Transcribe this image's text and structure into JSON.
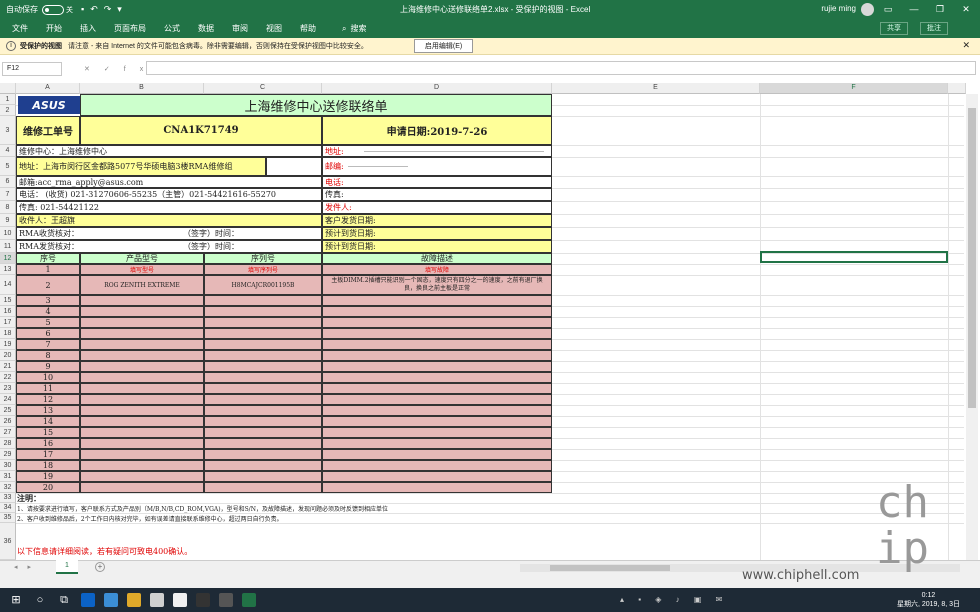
{
  "titlebar": {
    "autosave": "自动保存",
    "autosave_state": "关",
    "title": "上海维修中心送修联络单2.xlsx  -  受保护的视图  -  Excel",
    "user": "rujie ming"
  },
  "menu": {
    "items": [
      "文件",
      "开始",
      "插入",
      "页面布局",
      "公式",
      "数据",
      "审阅",
      "视图",
      "帮助"
    ],
    "search": "搜索",
    "share": "共享",
    "comment": "批注"
  },
  "protected_bar": {
    "label": "受保护的视图",
    "message": "请注意 - 来自 Internet 的文件可能包含病毒。除非需要编辑，否则保持在受保护视图中比较安全。",
    "button": "启用编辑(E)"
  },
  "formula_bar": {
    "name_box": "F12",
    "cancel": "✕",
    "confirm": "✓",
    "fx": "fx"
  },
  "columns": [
    "A",
    "B",
    "C",
    "D",
    "E",
    "F"
  ],
  "rows": [
    "1",
    "2",
    "3",
    "4",
    "5",
    "6",
    "7",
    "8",
    "9",
    "10",
    "11",
    "12",
    "13",
    "14",
    "15",
    "16",
    "17",
    "18",
    "19",
    "20",
    "21",
    "22",
    "23",
    "24",
    "25",
    "26",
    "27",
    "28",
    "29",
    "30",
    "31",
    "32",
    "33",
    "34",
    "35",
    "36"
  ],
  "sheet": {
    "logo": "ASUS",
    "title": "上海维修中心送修联络单",
    "ticket_label": "维修工单号",
    "ticket_no": "CNA1K71749",
    "apply_date": "申请日期:2019-7-26",
    "center": "维修中心：上海维修中心",
    "address_label": "地址:",
    "center_address": "地址：上海市闵行区金都路5077号华硕电脑3楼RMA维修组",
    "zip_label": "邮编:",
    "email": "邮箱:acc_rma_apply@asus.com",
    "phone_label_r": "电话:",
    "phone": "电话：  (收货)  021-31270606-55235（主管）021-54421616-55270",
    "fax_r": "传真:",
    "fax": "传真:     021-54421122",
    "sender": "发件人:",
    "recipient": "收件人：王超旗",
    "ship_date": "客户发货日期:",
    "rma_recv": "RMA收货核对：",
    "sign_time": "（签字）时间：",
    "expect_1": "预计到货日期:",
    "rma_send": "RMA发货核对：",
    "expect_2": "预计到货日期:",
    "headers": [
      "序号",
      "产品型号",
      "序列号",
      "故障描述"
    ],
    "hints": [
      "填写型号",
      "填写序列号",
      "填写故障"
    ],
    "item_model": "ROG ZENITH EXTREME",
    "item_serial": "H8MCAJCR001195B",
    "item_fault": "主板DIMM.2插槽只能识别一个固态，速度只有四分之一的速度，之前有退厂换良，换良之前主板是正常",
    "seq": [
      "1",
      "2",
      "3",
      "4",
      "5",
      "6",
      "7",
      "8",
      "9",
      "10",
      "11",
      "12",
      "13",
      "14",
      "15",
      "16",
      "17",
      "18",
      "19",
      "20"
    ],
    "note_title": "注明：",
    "note_1": "1、请按要求进行填写，客户联系方式及产品别（M/B,N/B,CD_ROM,VGA)，型号和S/N，及故障描述，发现问题必须及时反馈到相应单位",
    "note_2": "2、客户收到维修品后，2个工作日内核对完毕，如有误差请直接联系维修中心，超过两日自行负责。",
    "footer_red": "以下信息请详细阅读，若有疑问可致电400确认。"
  },
  "tabs": {
    "sheet1": "1",
    "add": "+"
  },
  "taskbar": {
    "time": "0:12",
    "date": "星期六, 2019, 8, 3日"
  },
  "watermark": "www.chiphell.com",
  "colors": {
    "excel_green": "#217346",
    "title_green": "#ccffcc",
    "yellow": "#ffff99",
    "pink": "#e6b8b7"
  }
}
